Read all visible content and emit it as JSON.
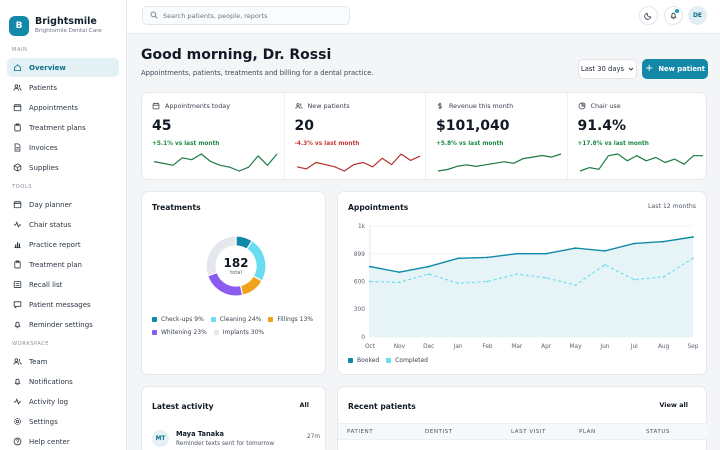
{
  "brand": {
    "initial": "B",
    "name": "Brightsmile",
    "subtitle": "Brightsmile Dental Care"
  },
  "sidebar": {
    "sections": [
      {
        "title": "MAIN",
        "items": [
          "Overview",
          "Patients",
          "Appointments",
          "Treatment plans",
          "Invoices",
          "Supplies"
        ]
      },
      {
        "title": "TOOLS",
        "items": [
          "Day planner",
          "Chair status",
          "Practice report",
          "Treatment plan",
          "Recall list",
          "Patient messages",
          "Reminder settings"
        ]
      },
      {
        "title": "WORKSPACE",
        "items": [
          "Team",
          "Notifications",
          "Activity log",
          "Settings",
          "Help center"
        ]
      }
    ],
    "active": "Overview"
  },
  "topbar": {
    "search_placeholder": "Search patients, people, reports",
    "user_initials": "DE"
  },
  "header": {
    "greeting": "Good morning, Dr. Rossi",
    "subtitle": "Appointments, patients, treatments and billing for a dental practice.",
    "range_label": "Last 30 days",
    "new_patient_label": "New patient"
  },
  "stats": [
    {
      "label": "Appointments today",
      "value": "45",
      "delta": "+5.1% vs last month",
      "trend": "up",
      "color": "#1e7a44",
      "spark": [
        10,
        9,
        8,
        12,
        11,
        14,
        10,
        8,
        7,
        5,
        7,
        13,
        8,
        14
      ]
    },
    {
      "label": "New patients",
      "value": "20",
      "delta": "-4.3% vs last month",
      "trend": "down",
      "color": "#b3312d",
      "spark": [
        8,
        7,
        10,
        9,
        8,
        6,
        9,
        10,
        8,
        12,
        9,
        14,
        11,
        13
      ]
    },
    {
      "label": "Revenue this month",
      "value": "$101,040",
      "delta": "+5.8% vs last month",
      "trend": "up",
      "color": "#1e7a44",
      "spark": [
        3,
        4,
        6,
        7,
        6,
        7,
        8,
        9,
        8,
        11,
        12,
        13,
        12,
        14
      ]
    },
    {
      "label": "Chair use",
      "value": "91.4%",
      "delta": "+17.8% vs last month",
      "trend": "up",
      "color": "#1e7a44",
      "spark": [
        4,
        6,
        5,
        13,
        14,
        10,
        13,
        10,
        12,
        9,
        11,
        8,
        13,
        13
      ]
    }
  ],
  "treatments": {
    "title": "Treatments",
    "total": "182",
    "total_label": "total",
    "segments": [
      {
        "label": "Check-ups",
        "pct": 9,
        "legend": "Check-ups 9%",
        "color": "#0e8aa8"
      },
      {
        "label": "Cleaning",
        "pct": 24,
        "legend": "Cleaning 24%",
        "color": "#6adcef"
      },
      {
        "label": "Fillings",
        "pct": 13,
        "legend": "Fillings 13%",
        "color": "#f0a21b"
      },
      {
        "label": "Whitening",
        "pct": 23,
        "legend": "Whitening 23%",
        "color": "#8a5cf0"
      },
      {
        "label": "Implants",
        "pct": 30,
        "legend": "Implants 30%",
        "color": "#e4e7ec"
      }
    ]
  },
  "chart_data": {
    "type": "line",
    "title": "Appointments",
    "range_label": "Last 12 months",
    "categories": [
      "Oct",
      "Nov",
      "Dec",
      "Jan",
      "Feb",
      "Mar",
      "Apr",
      "May",
      "Jun",
      "Jul",
      "Aug",
      "Sep"
    ],
    "y_ticks": [
      "0",
      "300",
      "600",
      "899",
      "1k"
    ],
    "ylim": [
      0,
      1199
    ],
    "series": [
      {
        "name": "Booked",
        "color": "#0e8aa8",
        "dashed": false,
        "values": [
          760,
          700,
          760,
          850,
          860,
          900,
          900,
          960,
          930,
          1010,
          1030,
          1080
        ]
      },
      {
        "name": "Completed",
        "color": "#6adcef",
        "dashed": true,
        "values": [
          600,
          590,
          680,
          580,
          600,
          680,
          640,
          560,
          780,
          620,
          650,
          850
        ]
      }
    ],
    "grid": true,
    "legend": "bottom-left"
  },
  "activity": {
    "title": "Latest activity",
    "all_label": "All",
    "items": [
      {
        "initials": "MT",
        "name": "Maya Tanaka",
        "desc": "Reminder texts sent for tomorrow",
        "time": "27m"
      }
    ]
  },
  "recent_patients": {
    "title": "Recent patients",
    "view_all": "View all",
    "columns": [
      "PATIENT",
      "DENTIST",
      "LAST VISIT",
      "PLAN",
      "STATUS"
    ]
  }
}
